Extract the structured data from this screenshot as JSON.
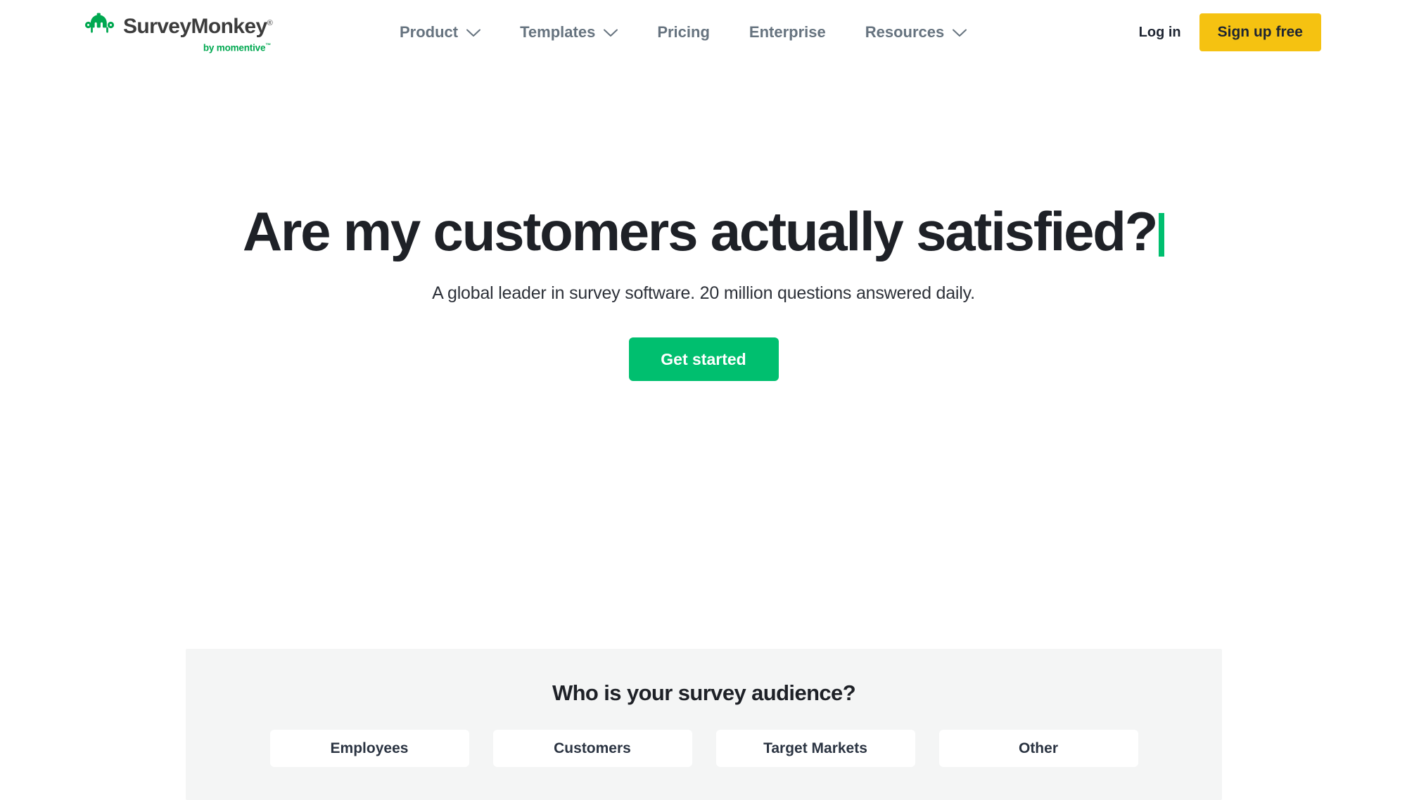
{
  "brand": {
    "name": "SurveyMonkey",
    "registered_mark": "®",
    "tagline": "by momentive",
    "tagline_mark": "™",
    "logo_green": "#00a850",
    "wordmark_color": "#3c3c3c"
  },
  "nav": {
    "items": [
      {
        "label": "Product",
        "has_dropdown": true
      },
      {
        "label": "Templates",
        "has_dropdown": true
      },
      {
        "label": "Pricing",
        "has_dropdown": false
      },
      {
        "label": "Enterprise",
        "has_dropdown": false
      },
      {
        "label": "Resources",
        "has_dropdown": true
      }
    ]
  },
  "auth": {
    "login_label": "Log in",
    "signup_label": "Sign up free",
    "signup_color": "#f5c211"
  },
  "hero": {
    "title": "Are my customers actually satisfied?",
    "caret_color": "#00bf6f",
    "subtitle": "A global leader in survey software. 20 million questions answered daily.",
    "cta_label": "Get started",
    "cta_color": "#00bf6f"
  },
  "audience": {
    "title": "Who is your survey audience?",
    "options": [
      {
        "label": "Employees"
      },
      {
        "label": "Customers"
      },
      {
        "label": "Target Markets"
      },
      {
        "label": "Other"
      }
    ]
  }
}
